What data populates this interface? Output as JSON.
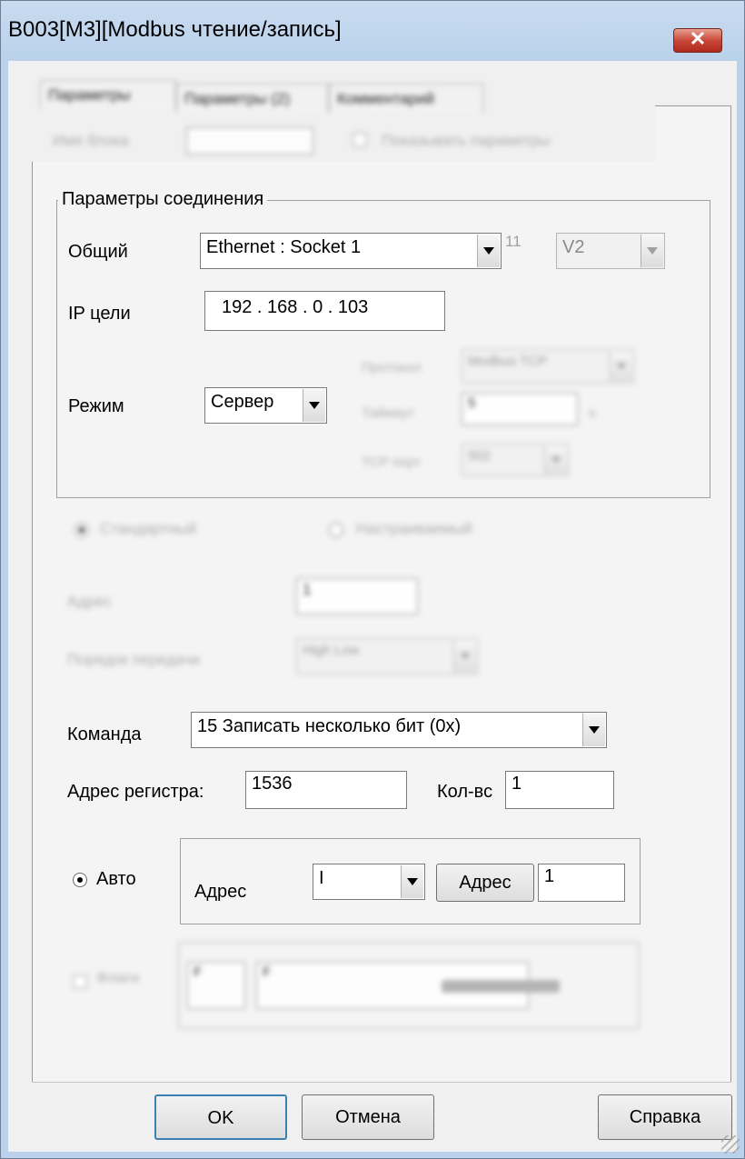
{
  "window": {
    "title": "B003[M3][Modbus чтение/запись]",
    "close_glyph": "✕"
  },
  "blurred": {
    "tabs": [
      "Параметры",
      "Параметры (2)",
      "Комментарий"
    ],
    "blockname_label": "Имя блока",
    "show_params_label": "Показывать параметры",
    "standard_label": "Стандартный",
    "custom_label": "Настраиваемый",
    "address_label": "Адрес",
    "address_value": "1",
    "byte_order_label": "Порядок передачи",
    "byte_order_value": "High Low",
    "protocol_label": "Протокол",
    "protocol_value": "Modbus TCP",
    "timeout_label": "Таймаут",
    "timeout_value": "5",
    "timeout_unit": "s",
    "tcp_port_label": "TCP порт",
    "tcp_port_value": "502",
    "flag_label": "Флаги",
    "flag_val1": "F",
    "flag_val2": "F"
  },
  "connection": {
    "group_title": "Параметры соединения",
    "general_label": "Общий",
    "general_value": "Ethernet : Socket 1",
    "general_extra": "11",
    "version_value": "V2",
    "ip_label": "IP цели",
    "ip_value": "192 . 168 .   0  . 103",
    "mode_label": "Режим",
    "mode_value": "Сервер"
  },
  "command": {
    "label": "Команда",
    "value": "15 Записать несколько бит (0x)",
    "reg_addr_label": "Адрес регистра:",
    "reg_addr_value": "1536",
    "count_label": "Кол-вс",
    "count_value": "1"
  },
  "auto": {
    "radio_label": "Авто",
    "address_label": "Адрес",
    "address_type": "I",
    "address_button": "Адрес",
    "address_value": "1"
  },
  "footer": {
    "ok": "OK",
    "cancel": "Отмена",
    "help": "Справка"
  }
}
